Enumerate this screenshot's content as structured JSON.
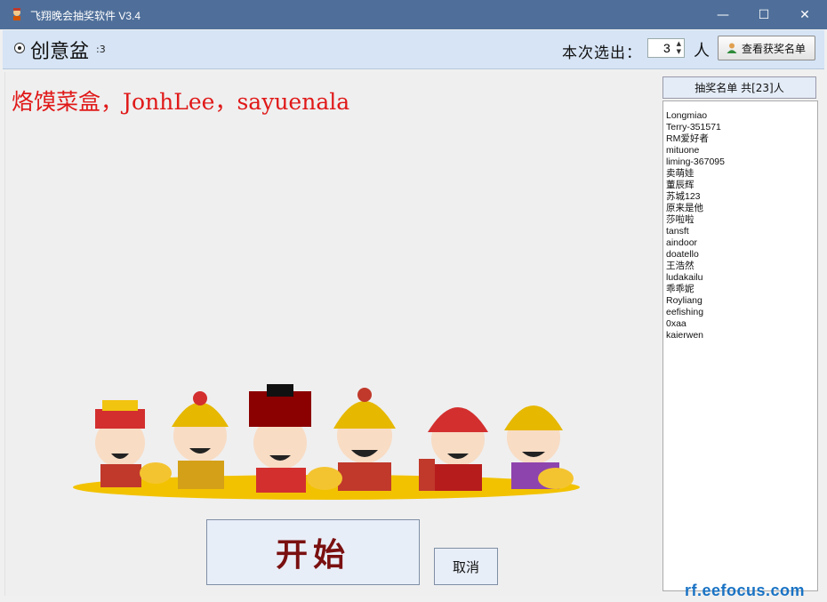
{
  "window": {
    "title": "飞翔晚会抽奖软件 V3.4",
    "minimize_label": "—",
    "maximize_label": "☐",
    "close_label": "✕"
  },
  "toolbar": {
    "project_name": "创意盆",
    "project_suffix": ":3",
    "count_label": "本次选出：",
    "count_value": "3",
    "count_unit": "人",
    "view_winners_label": "查看获奖名单"
  },
  "main": {
    "winners_text": "烙馍菜盒，JonhLee，sayuenala",
    "start_label": "开始",
    "cancel_label": "取消"
  },
  "sidebar": {
    "header": "抽奖名单 共[23]人",
    "names": [
      "Longmiao",
      "Terry-351571",
      "RM爱好者",
      "mituone",
      "liming-367095",
      "卖萌娃",
      "董辰辉",
      "苏城123",
      "原来是他",
      "莎啦啦",
      "tansft",
      "aindoor",
      "doatello",
      "王浩然",
      "ludakailu",
      "乖乖妮",
      "Royliang",
      "eefishing",
      "0xaa",
      "kaierwen"
    ]
  },
  "watermark": "rf.eefocus.com",
  "colors": {
    "titlebar": "#4f6f9a",
    "toolbar": "#d6e4f5",
    "winners_text": "#e01818",
    "start_text": "#7a1010",
    "watermark": "#1a73c4"
  }
}
